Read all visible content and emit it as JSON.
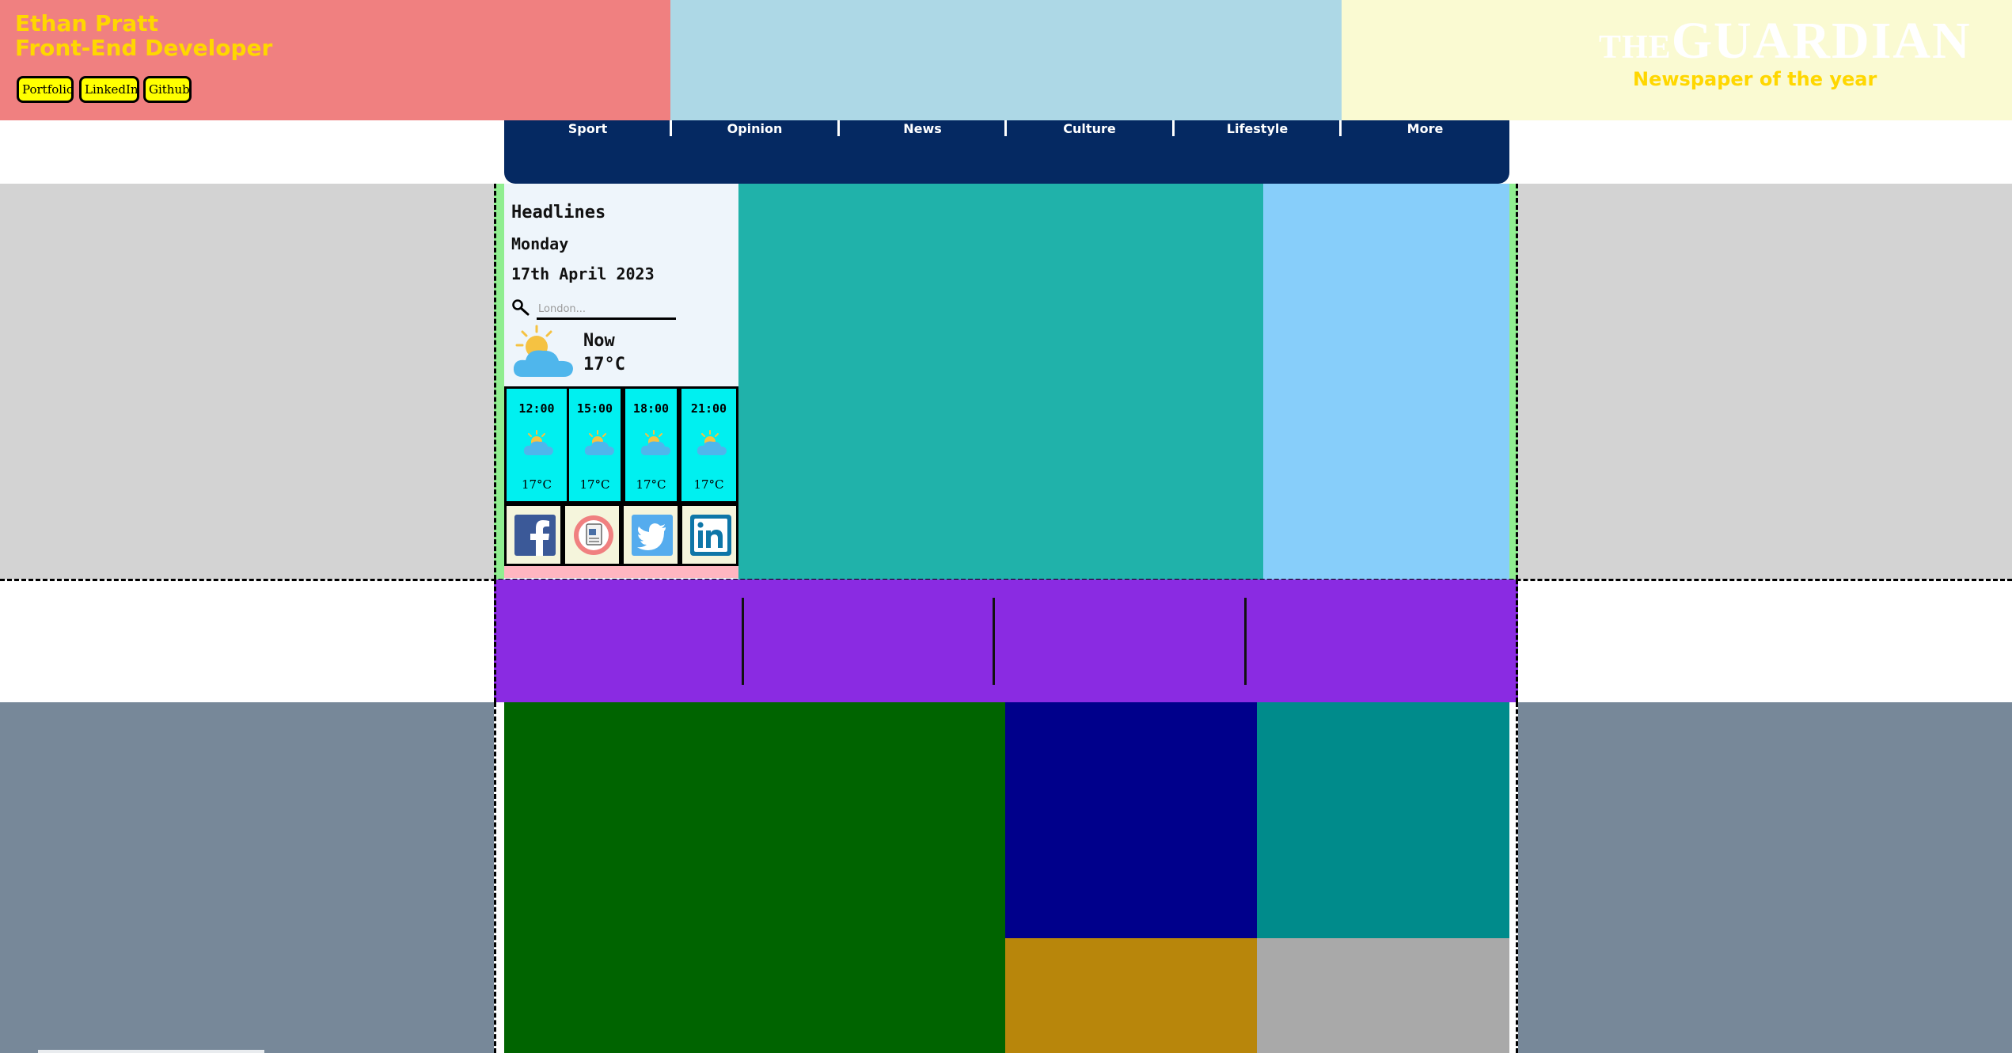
{
  "profile": {
    "name": "Ethan Pratt",
    "role": "Front-End Developer",
    "links": [
      "Portfolio",
      "LinkedIn",
      "Github"
    ]
  },
  "brand": {
    "the": "THE",
    "guardian": "GUARDIAN",
    "tagline": "Newspaper of the year"
  },
  "nav": [
    "Sport",
    "Opinion",
    "News",
    "Culture",
    "Lifestyle",
    "More"
  ],
  "weather": {
    "heading": "Headlines",
    "day": "Monday",
    "date": "17th April 2023",
    "search_placeholder": "London...",
    "now_label": "Now",
    "now_temp": "17°C",
    "hourly": [
      {
        "time": "12:00",
        "temp": "17°C"
      },
      {
        "time": "15:00",
        "temp": "17°C"
      },
      {
        "time": "18:00",
        "temp": "17°C"
      },
      {
        "time": "21:00",
        "temp": "17°C"
      }
    ]
  },
  "social": [
    "facebook-icon",
    "news-app-icon",
    "twitter-icon",
    "linkedin-icon"
  ],
  "colors": {
    "header_left": "#f08080",
    "header_mid": "#add8e6",
    "header_right": "#fafad2",
    "nav_bg": "#052962",
    "accent_text": "#ffd700",
    "purple_band": "#8a2be2"
  }
}
